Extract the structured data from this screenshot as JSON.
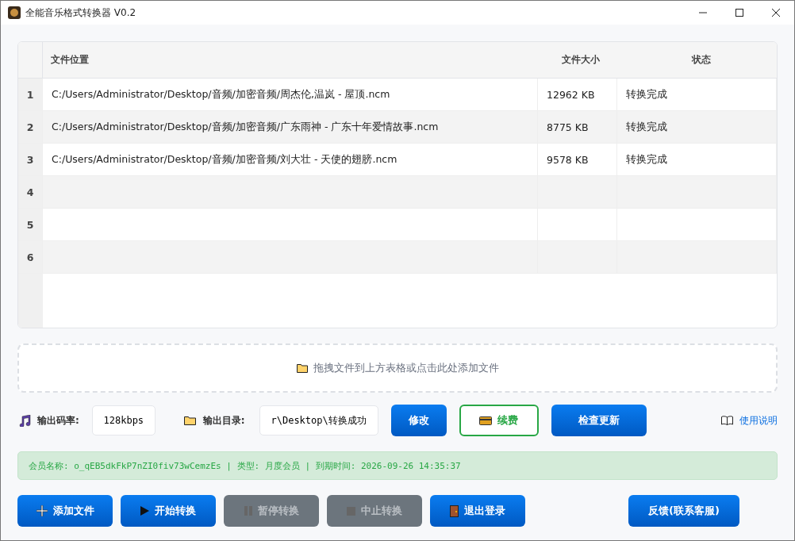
{
  "window": {
    "title": "全能音乐格式转换器 V0.2"
  },
  "table": {
    "columns": [
      "文件位置",
      "文件大小",
      "状态"
    ],
    "rows": [
      {
        "number": "1",
        "cells": [
          "C:/Users/Administrator/Desktop/音频/加密音频/周杰伦,温岚 - 屋顶.ncm",
          "12962 KB",
          "转换完成"
        ]
      },
      {
        "number": "2",
        "cells": [
          "C:/Users/Administrator/Desktop/音频/加密音频/广东雨神 - 广东十年爱情故事.ncm",
          "8775 KB",
          "转换完成"
        ]
      },
      {
        "number": "3",
        "cells": [
          "C:/Users/Administrator/Desktop/音频/加密音频/刘大壮 - 天使的翅膀.ncm",
          "9578 KB",
          "转换完成"
        ]
      },
      {
        "number": "4"
      },
      {
        "number": "5"
      },
      {
        "number": "6"
      }
    ]
  },
  "drop_zone": {
    "text": "拖拽文件到上方表格或点击此处添加文件"
  },
  "settings": {
    "bitrate_label": "输出码率:",
    "bitrate_value": "128kbps",
    "output_dir_label": "输出目录:",
    "output_dir_value": "r\\Desktop\\转换成功",
    "buttons": [
      {
        "kind": "primary",
        "label": "修改"
      },
      {
        "kind": "outline",
        "label": "续费"
      },
      {
        "kind": "primary",
        "label": "检查更新"
      }
    ],
    "help_link": "使用说明"
  },
  "member_bar": {
    "text": "会员名称: o_qEB5dkFkP7nZI0fiv73wCemzEs | 类型: 月度会员 | 到期时间: 2026-09-26 14:35:37"
  },
  "actions": [
    {
      "label": "添加文件",
      "disabled": false
    },
    {
      "label": "开始转换",
      "disabled": false
    },
    {
      "label": "暂停转换",
      "disabled": true
    },
    {
      "label": "中止转换",
      "disabled": true
    },
    {
      "label": "退出登录",
      "disabled": false
    }
  ],
  "feedback_button": "反馈(联系客服)"
}
